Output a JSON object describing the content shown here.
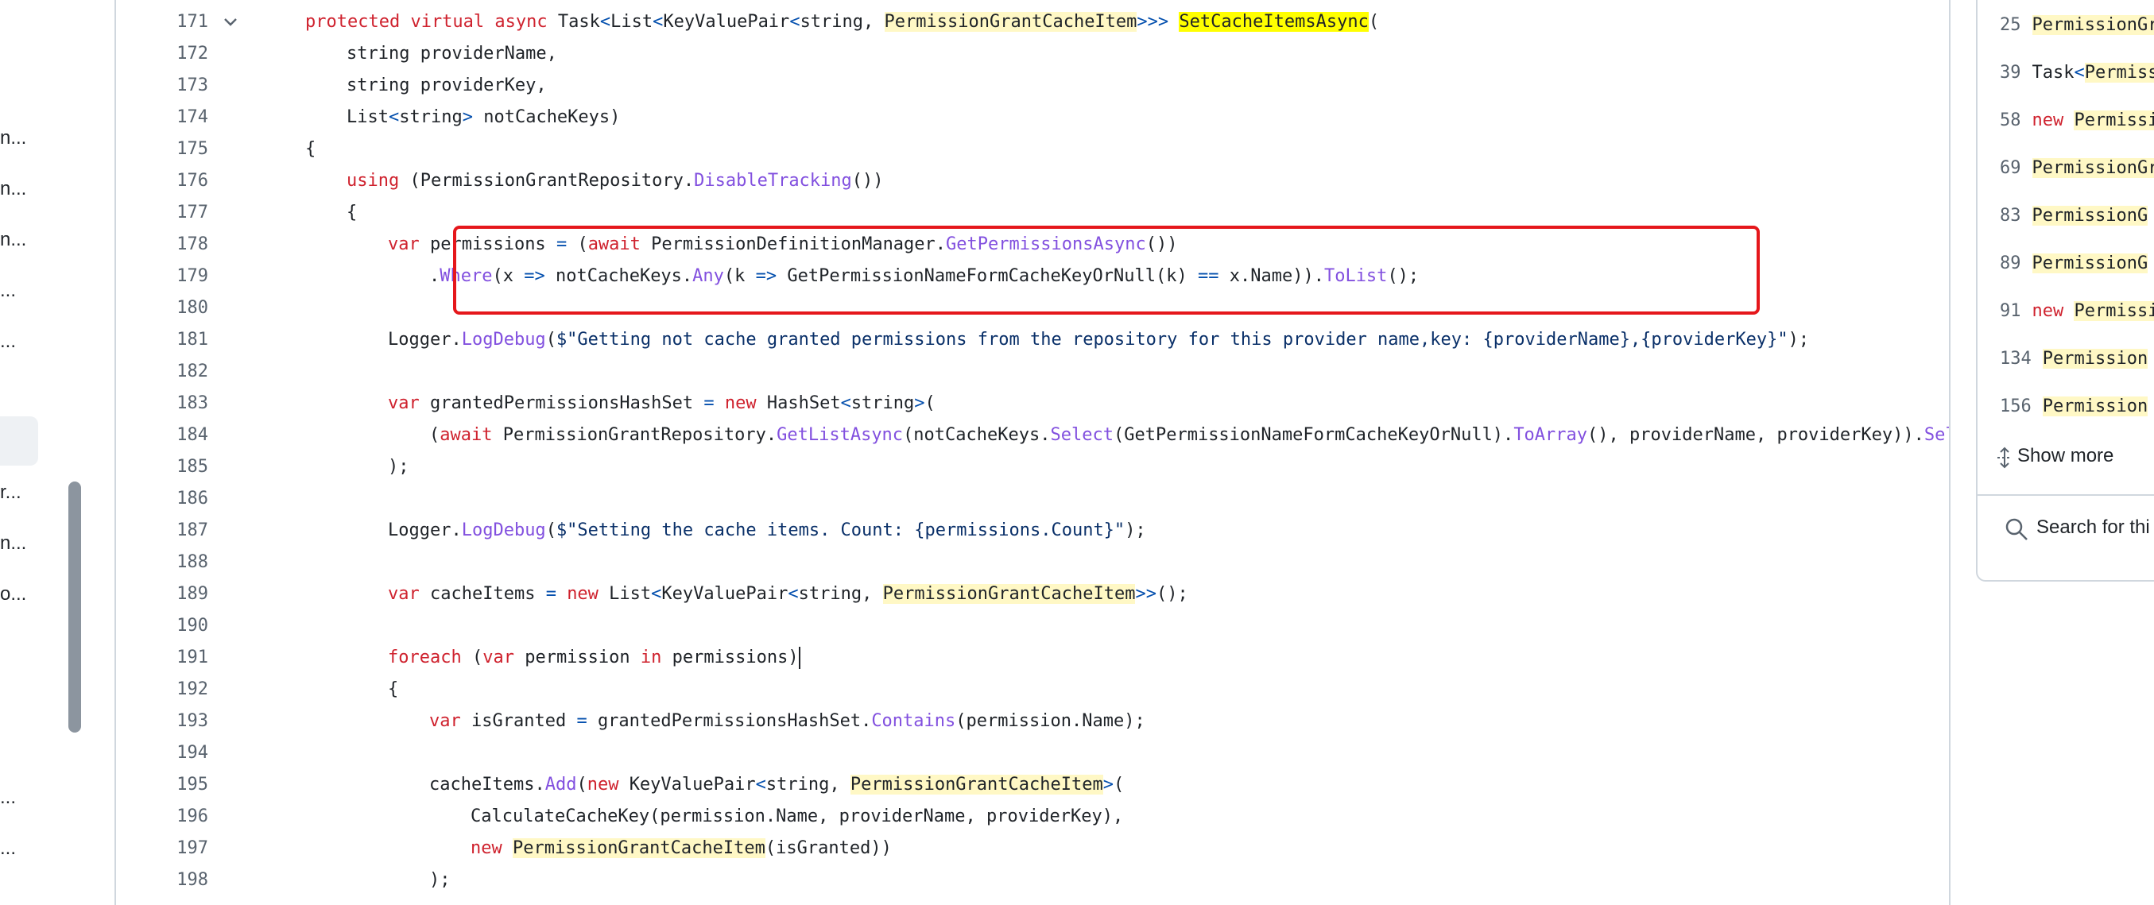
{
  "file_tree": {
    "items": [
      "n...",
      "n...",
      "n...",
      "...",
      "...",
      "r...",
      "n...",
      "o...",
      "...",
      "..."
    ]
  },
  "code": {
    "lines": [
      {
        "n": "171",
        "fold": true,
        "indent": 0,
        "tokens": [
          [
            "k",
            "protected virtual async "
          ],
          [
            "t",
            "Task"
          ],
          [
            "op",
            "<"
          ],
          [
            "t",
            "List"
          ],
          [
            "op",
            "<"
          ],
          [
            "t",
            "KeyValuePair"
          ],
          [
            "op",
            "<"
          ],
          [
            "t",
            "string, "
          ],
          [
            "hl",
            "PermissionGrantCacheItem"
          ],
          [
            "op",
            ">>> "
          ],
          [
            "hl2",
            "SetCacheItemsAsync"
          ],
          [
            "t",
            "("
          ]
        ]
      },
      {
        "n": "172",
        "indent": 1,
        "tokens": [
          [
            "t",
            "string providerName,"
          ]
        ]
      },
      {
        "n": "173",
        "indent": 1,
        "tokens": [
          [
            "t",
            "string providerKey,"
          ]
        ]
      },
      {
        "n": "174",
        "indent": 1,
        "tokens": [
          [
            "t",
            "List"
          ],
          [
            "op",
            "<"
          ],
          [
            "t",
            "string"
          ],
          [
            "op",
            "> "
          ],
          [
            "t",
            "notCacheKeys)"
          ]
        ]
      },
      {
        "n": "175",
        "indent": 0,
        "tokens": [
          [
            "t",
            "{"
          ]
        ]
      },
      {
        "n": "176",
        "indent": 1,
        "tokens": [
          [
            "k",
            "using "
          ],
          [
            "t",
            "(PermissionGrantRepository."
          ],
          [
            "m",
            "DisableTracking"
          ],
          [
            "t",
            "())"
          ]
        ]
      },
      {
        "n": "177",
        "indent": 1,
        "tokens": [
          [
            "t",
            "{"
          ]
        ]
      },
      {
        "n": "178",
        "indent": 2,
        "tokens": [
          [
            "k",
            "var "
          ],
          [
            "t",
            "permissions "
          ],
          [
            "op",
            "= "
          ],
          [
            "t",
            "("
          ],
          [
            "k",
            "await "
          ],
          [
            "t",
            "PermissionDefinitionManager."
          ],
          [
            "m",
            "GetPermissionsAsync"
          ],
          [
            "t",
            "())"
          ]
        ]
      },
      {
        "n": "179",
        "indent": 3,
        "tokens": [
          [
            "t",
            "."
          ],
          [
            "m",
            "Where"
          ],
          [
            "t",
            "(x "
          ],
          [
            "op",
            "=> "
          ],
          [
            "t",
            "notCacheKeys."
          ],
          [
            "m",
            "Any"
          ],
          [
            "t",
            "(k "
          ],
          [
            "op",
            "=> "
          ],
          [
            "t",
            "GetPermissionNameFormCacheKeyOrNull(k) "
          ],
          [
            "op",
            "== "
          ],
          [
            "t",
            "x.Name))."
          ],
          [
            "m",
            "ToList"
          ],
          [
            "t",
            "();"
          ]
        ]
      },
      {
        "n": "180",
        "indent": 0,
        "tokens": []
      },
      {
        "n": "181",
        "indent": 2,
        "tokens": [
          [
            "t",
            "Logger."
          ],
          [
            "m",
            "LogDebug"
          ],
          [
            "t",
            "("
          ],
          [
            "s",
            "$\"Getting not cache granted permissions from the repository for this provider name,key: {providerName},{providerKey}\""
          ],
          [
            "t",
            ");"
          ]
        ]
      },
      {
        "n": "182",
        "indent": 0,
        "tokens": []
      },
      {
        "n": "183",
        "indent": 2,
        "tokens": [
          [
            "k",
            "var "
          ],
          [
            "t",
            "grantedPermissionsHashSet "
          ],
          [
            "op",
            "= "
          ],
          [
            "k",
            "new "
          ],
          [
            "t",
            "HashSet"
          ],
          [
            "op",
            "<"
          ],
          [
            "t",
            "string"
          ],
          [
            "op",
            ">"
          ],
          [
            "t",
            "("
          ]
        ]
      },
      {
        "n": "184",
        "indent": 3,
        "tokens": [
          [
            "t",
            "("
          ],
          [
            "k",
            "await "
          ],
          [
            "t",
            "PermissionGrantRepository."
          ],
          [
            "m",
            "GetListAsync"
          ],
          [
            "t",
            "(notCacheKeys."
          ],
          [
            "m",
            "Select"
          ],
          [
            "t",
            "(GetPermissionNameFormCacheKeyOrNull)."
          ],
          [
            "m",
            "ToArray"
          ],
          [
            "t",
            "(), providerName, providerKey))."
          ],
          [
            "m",
            "Sel"
          ]
        ]
      },
      {
        "n": "185",
        "indent": 2,
        "tokens": [
          [
            "t",
            ");"
          ]
        ]
      },
      {
        "n": "186",
        "indent": 0,
        "tokens": []
      },
      {
        "n": "187",
        "indent": 2,
        "tokens": [
          [
            "t",
            "Logger."
          ],
          [
            "m",
            "LogDebug"
          ],
          [
            "t",
            "("
          ],
          [
            "s",
            "$\"Setting the cache items. Count: {permissions.Count}\""
          ],
          [
            "t",
            ");"
          ]
        ]
      },
      {
        "n": "188",
        "indent": 0,
        "tokens": []
      },
      {
        "n": "189",
        "indent": 2,
        "tokens": [
          [
            "k",
            "var "
          ],
          [
            "t",
            "cacheItems "
          ],
          [
            "op",
            "= "
          ],
          [
            "k",
            "new "
          ],
          [
            "t",
            "List"
          ],
          [
            "op",
            "<"
          ],
          [
            "t",
            "KeyValuePair"
          ],
          [
            "op",
            "<"
          ],
          [
            "t",
            "string, "
          ],
          [
            "hl",
            "PermissionGrantCacheItem"
          ],
          [
            "op",
            ">>"
          ],
          [
            "t",
            "();"
          ]
        ]
      },
      {
        "n": "190",
        "indent": 0,
        "tokens": []
      },
      {
        "n": "191",
        "indent": 2,
        "cursor": true,
        "tokens": [
          [
            "k",
            "foreach "
          ],
          [
            "t",
            "("
          ],
          [
            "k",
            "var "
          ],
          [
            "t",
            "permission "
          ],
          [
            "k",
            "in "
          ],
          [
            "t",
            "permissions)"
          ]
        ]
      },
      {
        "n": "192",
        "indent": 2,
        "tokens": [
          [
            "t",
            "{"
          ]
        ]
      },
      {
        "n": "193",
        "indent": 3,
        "tokens": [
          [
            "k",
            "var "
          ],
          [
            "t",
            "isGranted "
          ],
          [
            "op",
            "= "
          ],
          [
            "t",
            "grantedPermissionsHashSet."
          ],
          [
            "m",
            "Contains"
          ],
          [
            "t",
            "(permission.Name);"
          ]
        ]
      },
      {
        "n": "194",
        "indent": 0,
        "tokens": []
      },
      {
        "n": "195",
        "indent": 3,
        "tokens": [
          [
            "t",
            "cacheItems."
          ],
          [
            "m",
            "Add"
          ],
          [
            "t",
            "("
          ],
          [
            "k",
            "new "
          ],
          [
            "t",
            "KeyValuePair"
          ],
          [
            "op",
            "<"
          ],
          [
            "t",
            "string, "
          ],
          [
            "hl",
            "PermissionGrantCacheItem"
          ],
          [
            "op",
            ">"
          ],
          [
            "t",
            "("
          ]
        ]
      },
      {
        "n": "196",
        "indent": 4,
        "tokens": [
          [
            "t",
            "CalculateCacheKey(permission.Name, providerName, providerKey),"
          ]
        ]
      },
      {
        "n": "197",
        "indent": 4,
        "tokens": [
          [
            "k",
            "new "
          ],
          [
            "hl",
            "PermissionGrantCacheItem"
          ],
          [
            "t",
            "(isGranted))"
          ]
        ]
      },
      {
        "n": "198",
        "indent": 3,
        "tokens": [
          [
            "t",
            ");"
          ]
        ]
      }
    ]
  },
  "symbols_panel": {
    "references": [
      {
        "line": "25",
        "tokens": [
          [
            "hl",
            "PermissionGr"
          ]
        ]
      },
      {
        "line": "39",
        "tokens": [
          [
            "t",
            "Task"
          ],
          [
            "op",
            "<"
          ],
          [
            "hl",
            "Permiss"
          ]
        ]
      },
      {
        "line": "58",
        "tokens": [
          [
            "k",
            "new "
          ],
          [
            "hl",
            "Permissi"
          ]
        ]
      },
      {
        "line": "69",
        "tokens": [
          [
            "hl",
            "PermissionGr"
          ]
        ]
      },
      {
        "line": "83",
        "tokens": [
          [
            "hl",
            "PermissionG"
          ]
        ]
      },
      {
        "line": "89",
        "tokens": [
          [
            "hl",
            "PermissionG"
          ]
        ]
      },
      {
        "line": "91",
        "tokens": [
          [
            "k",
            "new "
          ],
          [
            "hl",
            "Permissi"
          ]
        ]
      },
      {
        "line": "134",
        "tokens": [
          [
            "hl",
            "Permission"
          ]
        ]
      },
      {
        "line": "156",
        "tokens": [
          [
            "hl",
            "Permission"
          ]
        ]
      }
    ],
    "show_more_label": "Show more",
    "search_label": "Search for thi"
  }
}
